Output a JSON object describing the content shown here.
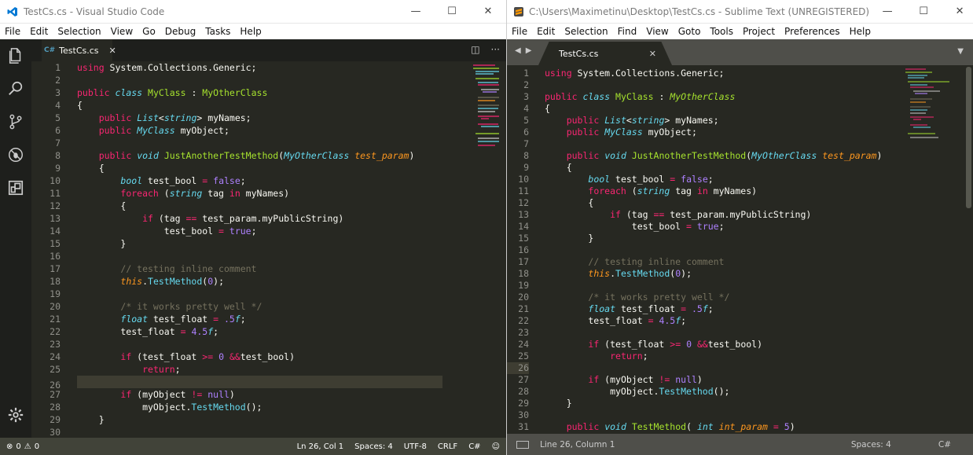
{
  "vscode": {
    "window_title": "TestCs.cs - Visual Studio Code",
    "menu": [
      "File",
      "Edit",
      "Selection",
      "View",
      "Go",
      "Debug",
      "Tasks",
      "Help"
    ],
    "tab_label": "TestCs.cs",
    "tab_icon_text": "C#",
    "status_errors": "0",
    "status_warnings": "0",
    "status_position": "Ln 26, Col 1",
    "status_spaces": "Spaces: 4",
    "status_encoding": "UTF-8",
    "status_eol": "CRLF",
    "status_language": "C#",
    "line_numbers": [
      "1",
      "2",
      "3",
      "4",
      "5",
      "6",
      "7",
      "8",
      "9",
      "10",
      "11",
      "12",
      "13",
      "14",
      "15",
      "16",
      "17",
      "18",
      "19",
      "20",
      "21",
      "22",
      "23",
      "24",
      "25",
      "26",
      "27",
      "28",
      "29",
      "30"
    ]
  },
  "sublime": {
    "window_title": "C:\\Users\\Maximetinu\\Desktop\\TestCs.cs - Sublime Text (UNREGISTERED)",
    "menu": [
      "File",
      "Edit",
      "Selection",
      "Find",
      "View",
      "Goto",
      "Tools",
      "Project",
      "Preferences",
      "Help"
    ],
    "tab_label": "TestCs.cs",
    "status_position": "Line 26, Column 1",
    "status_spaces": "Spaces: 4",
    "status_language": "C#",
    "line_numbers": [
      "1",
      "2",
      "3",
      "4",
      "5",
      "6",
      "7",
      "8",
      "9",
      "10",
      "11",
      "12",
      "13",
      "14",
      "15",
      "16",
      "17",
      "18",
      "19",
      "20",
      "21",
      "22",
      "23",
      "24",
      "25",
      "26",
      "27",
      "28",
      "29",
      "30",
      "31"
    ]
  },
  "colors": {
    "editor_bg": "#272822",
    "keyword": "#f92672",
    "type": "#66d9ef",
    "class": "#a6e22e",
    "number": "#ae81ff",
    "comment": "#75715e",
    "param": "#fd971f"
  },
  "icons": {
    "vscode_activity": [
      "files-icon",
      "search-icon",
      "source-control-icon",
      "debug-icon",
      "extensions-icon",
      "settings-gear-icon"
    ]
  }
}
